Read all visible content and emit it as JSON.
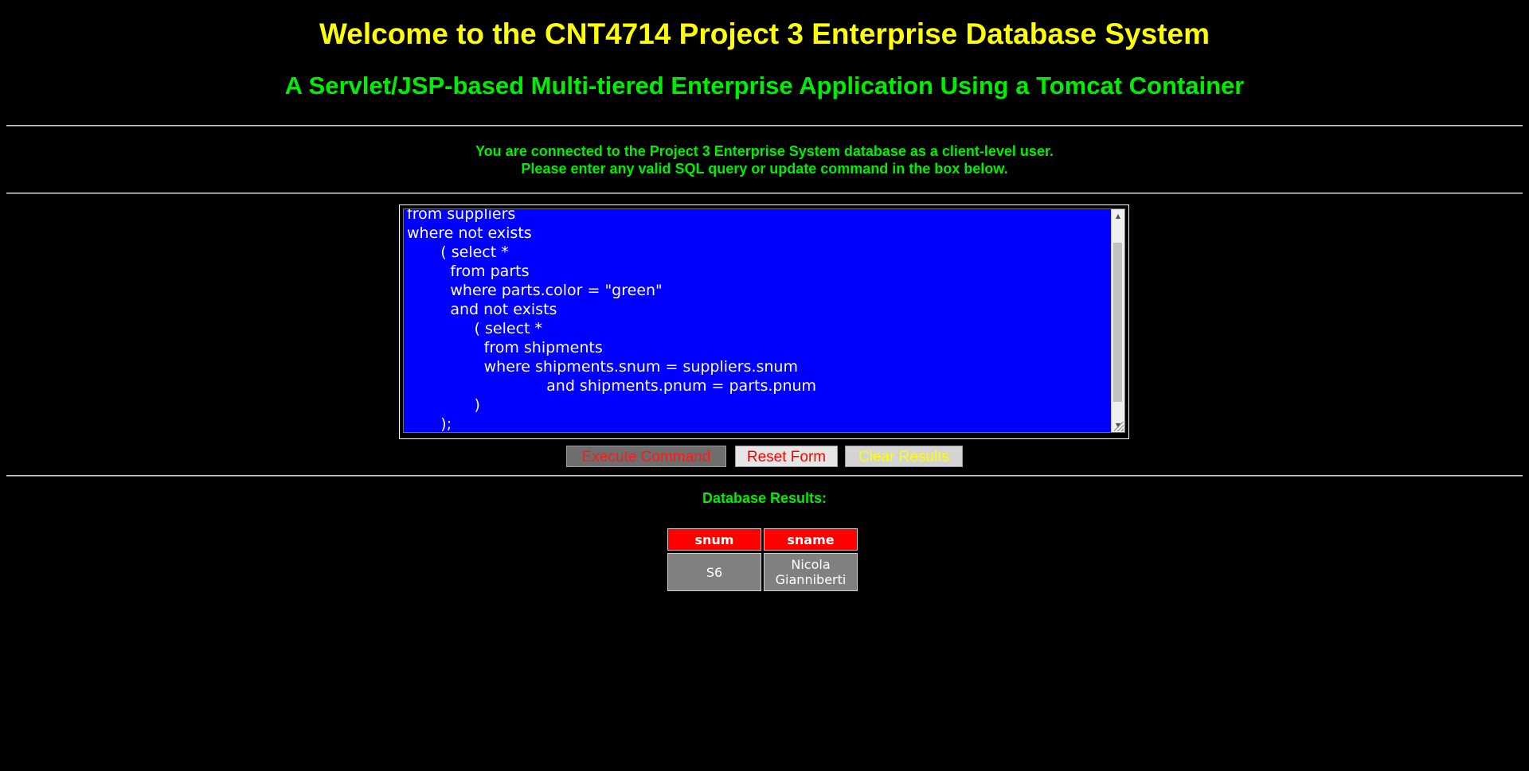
{
  "header": {
    "title": "Welcome to the CNT4714 Project 3 Enterprise Database System",
    "subtitle": "A Servlet/JSP-based Multi-tiered Enterprise Application Using a Tomcat Container"
  },
  "info": {
    "line1": "You are connected to the Project 3 Enterprise System database as a client-level user.",
    "line2": "Please enter any valid SQL query or update command in the box below."
  },
  "editor": {
    "content": "from suppliers\nwhere not exists\n       ( select *\n         from parts\n         where parts.color = \"green\"\n         and not exists\n              ( select *\n                from shipments\n                where shipments.snum = suppliers.snum\n                             and shipments.pnum = parts.pnum\n              )\n       );"
  },
  "buttons": {
    "execute": "Execute Command",
    "reset": "Reset Form",
    "clear": "Clear Results"
  },
  "results": {
    "label": "Database Results:",
    "columns": [
      "snum",
      "sname"
    ],
    "rows": [
      [
        "S6",
        "Nicola Gianniberti"
      ]
    ]
  },
  "colors": {
    "background": "#000000",
    "title": "#ffff00",
    "subtitle": "#00ee00",
    "editor_bg": "#0000ff",
    "table_header": "#ff0000",
    "table_cell": "#808080"
  }
}
